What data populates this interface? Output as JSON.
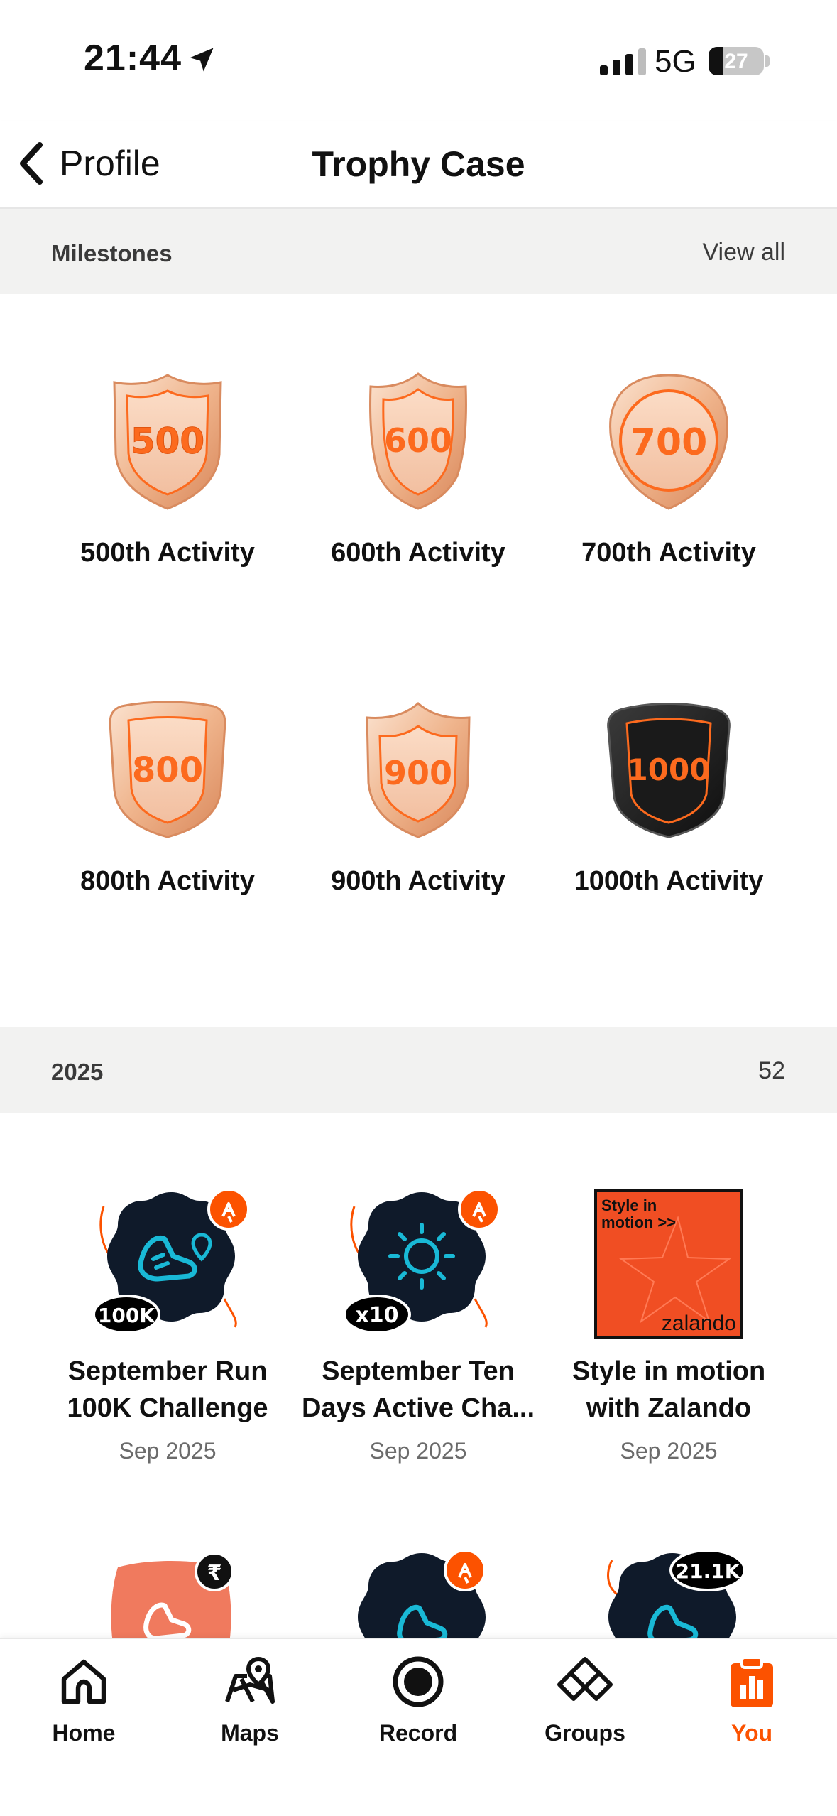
{
  "status_bar": {
    "time": "21:44",
    "network": "5G",
    "battery": "27"
  },
  "header": {
    "back_label": "Profile",
    "title": "Trophy Case"
  },
  "milestones": {
    "section_label": "Milestones",
    "view_all": "View all",
    "items": [
      {
        "badge": "500",
        "title": "500th Activity"
      },
      {
        "badge": "600",
        "title": "600th Activity"
      },
      {
        "badge": "700",
        "title": "700th Activity"
      },
      {
        "badge": "800",
        "title": "800th Activity"
      },
      {
        "badge": "900",
        "title": "900th Activity"
      },
      {
        "badge": "1000",
        "title": "1000th Activity"
      }
    ]
  },
  "year_section": {
    "section_label": "2025",
    "count": "52",
    "items": [
      {
        "badge_text": "100K",
        "title_line1": "September Run",
        "title_line2": "100K Challenge",
        "date": "Sep 2025"
      },
      {
        "badge_text": "x10",
        "title_line1": "September Ten",
        "title_line2": "Days Active Cha...",
        "date": "Sep 2025"
      },
      {
        "badge_line1": "Style in",
        "badge_line2": "motion >>",
        "badge_brand": "zalando",
        "title_line1": "Style in motion",
        "title_line2": "with Zalando",
        "date": "Sep 2025"
      },
      {
        "badge_text": ""
      },
      {
        "badge_text": ""
      },
      {
        "badge_text": "21.1K"
      }
    ]
  },
  "tabbar": {
    "tabs": [
      {
        "label": "Home"
      },
      {
        "label": "Maps"
      },
      {
        "label": "Record"
      },
      {
        "label": "Groups"
      },
      {
        "label": "You"
      }
    ]
  },
  "colors": {
    "accent": "#fc5200",
    "bronze": "#e9a77d",
    "challenge_dark": "#0f1a2a",
    "teal": "#19b9d6",
    "zalando_orange": "#f04e23"
  }
}
